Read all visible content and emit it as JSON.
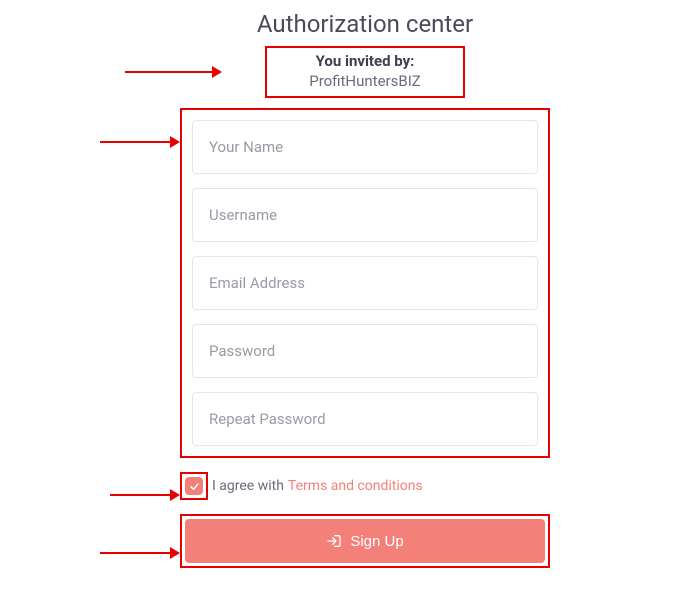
{
  "title": "Authorization center",
  "invited": {
    "label": "You invited by:",
    "name": "ProfitHuntersBIZ"
  },
  "fields": {
    "name_placeholder": "Your Name",
    "username_placeholder": "Username",
    "email_placeholder": "Email Address",
    "password_placeholder": "Password",
    "repeat_password_placeholder": "Repeat Password"
  },
  "agree": {
    "checked": true,
    "text": "I agree with",
    "link": "Terms and conditions"
  },
  "submit_label": "Sign Up",
  "colors": {
    "accent": "#f38079",
    "annotation": "#e60000"
  }
}
